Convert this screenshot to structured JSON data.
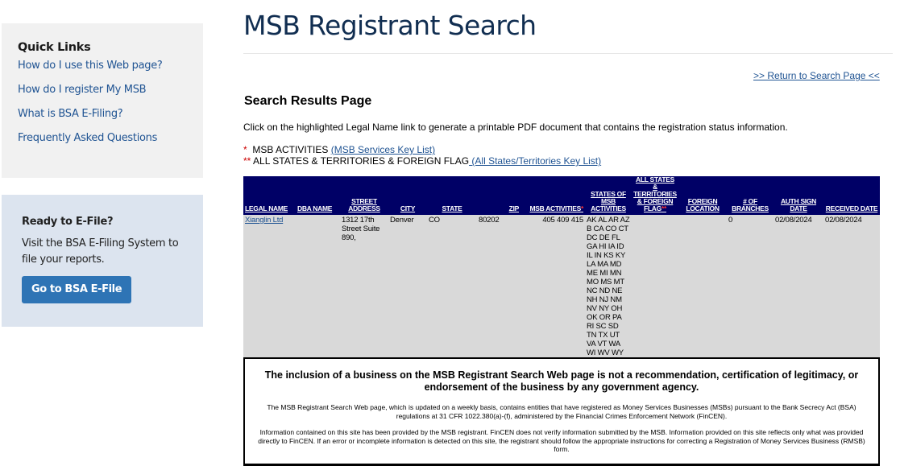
{
  "sidebar": {
    "quick_links": {
      "title": "Quick Links",
      "items": [
        {
          "label": "How do I use this Web page?"
        },
        {
          "label": "How do I register My MSB"
        },
        {
          "label": "What is BSA E-Filing?"
        },
        {
          "label": "Frequently Asked Questions"
        }
      ]
    },
    "efile": {
      "title": "Ready to E-File?",
      "text": "Visit the BSA E-Filing System to file your reports.",
      "button_label": "Go to BSA E-File"
    }
  },
  "header": {
    "title": "MSB Registrant Search",
    "return_link": ">> Return to Search Page <<"
  },
  "results": {
    "heading": "Search Results Page",
    "instructions": "Click on the highlighted Legal Name link to generate a printable PDF document that contains the registration status information.",
    "keys": [
      {
        "marker": "*",
        "label": "  MSB ACTIVITIES ",
        "link": "(MSB Services Key List)"
      },
      {
        "marker": "**",
        "label": " ALL STATES & TERRITORIES & FOREIGN FLAG",
        "link": " (All States/Territories Key List)"
      }
    ],
    "columns": [
      {
        "label": "LEGAL NAME",
        "marker": ""
      },
      {
        "label": "DBA NAME",
        "marker": ""
      },
      {
        "label": "STREET ADDRESS",
        "marker": ""
      },
      {
        "label": "CITY",
        "marker": ""
      },
      {
        "label": "STATE",
        "marker": ""
      },
      {
        "label": "ZIP",
        "marker": ""
      },
      {
        "label": "MSB ACTIVITIES",
        "marker": "*"
      },
      {
        "label": "STATES OF MSB ACTIVITIES",
        "marker": ""
      },
      {
        "label": "ALL STATES & TERRITORIES & FOREIGN FLAG",
        "marker": "**"
      },
      {
        "label": "FOREIGN LOCATION",
        "marker": ""
      },
      {
        "label": "# OF BRANCHES",
        "marker": ""
      },
      {
        "label": "AUTH SIGN DATE",
        "marker": ""
      },
      {
        "label": "RECEIVED DATE",
        "marker": ""
      }
    ],
    "rows": [
      {
        "legal_name": "Xianglin Ltd",
        "dba_name": "",
        "street_address": "1312 17th Street Suite 890,",
        "city": "Denver",
        "state": "CO",
        "zip": "80202",
        "msb_activities": "405 409 415",
        "states_of_msb_activities": "AK AL AR AZ B CA CO CT DC DE FL GA HI IA ID IL IN KS KY LA MA MD ME MI MN MO MS MT NC ND NE NH NJ NM NV NY OH OK OR PA RI SC SD TN TX UT VA VT WA WI WV WY",
        "all_states_flag": "",
        "foreign_location": "",
        "branches": "0",
        "auth_sign_date": "02/08/2024",
        "received_date": "02/08/2024"
      }
    ]
  },
  "disclaimer": {
    "main": "The inclusion of a business on the MSB Registrant Search Web page is not a recommendation, certification of legitimacy, or endorsement of the business by any government agency.",
    "paragraph1": "The MSB Registrant Search Web page, which is updated on a weekly basis, contains entities that have registered as Money Services Businesses (MSBs) pursuant to the Bank Secrecy Act (BSA) regulations at 31 CFR 1022.380(a)-(f), administered by the Financial Crimes Enforcement Network (FinCEN).",
    "paragraph2": "Information contained on this site has been provided by the MSB registrant. FinCEN does not verify information submitted by the MSB. Information provided on this site reflects only what was provided directly to FinCEN. If an error or incomplete information is detected on this site, the registrant should follow the appropriate instructions for correcting a Registration of Money Services Business (RMSB) form."
  }
}
